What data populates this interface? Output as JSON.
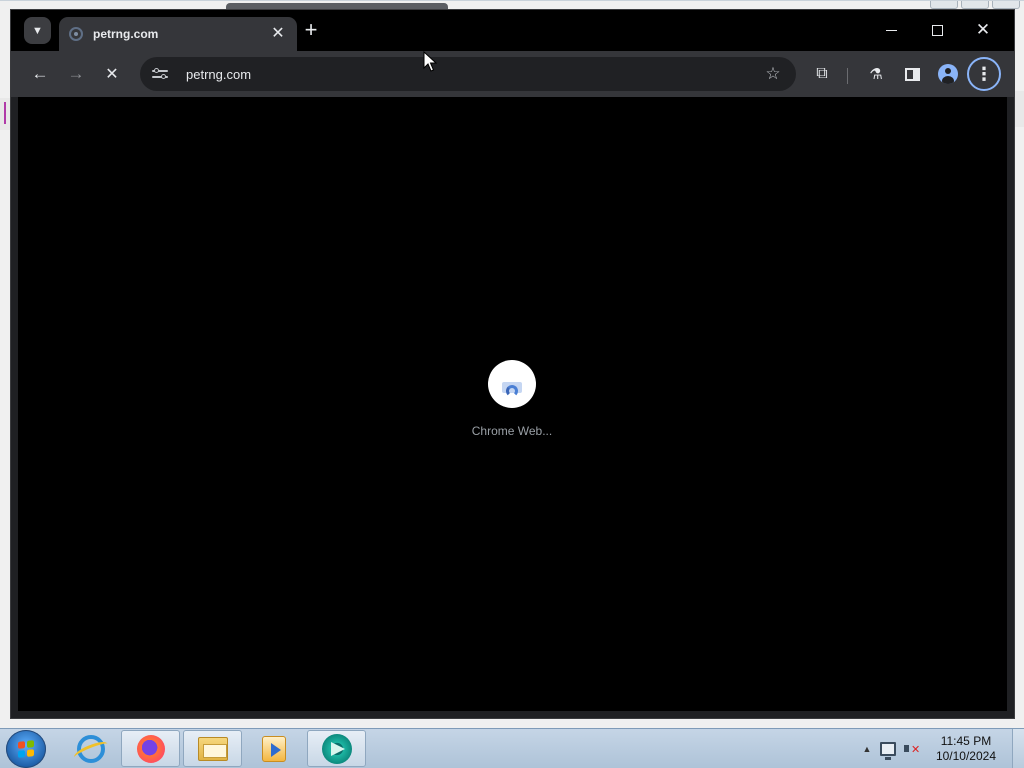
{
  "browser": {
    "tab": {
      "title": "petrng.com",
      "close_glyph": "✕"
    },
    "new_tab_glyph": "+",
    "window_controls": {
      "close_glyph": "✕"
    },
    "toolbar": {
      "back_glyph": "←",
      "forward_glyph": "→",
      "stop_glyph": "✕",
      "url": "petrng.com",
      "bookmark_glyph": "☆",
      "extensions_glyph": "⧉",
      "labs_glyph": "⚗",
      "menu_glyph": "⋮"
    },
    "page": {
      "loading_label": "Chrome Web..."
    }
  },
  "taskbar": {
    "pinned_apps": [
      "internet-explorer",
      "firefox",
      "windows-explorer",
      "windows-media-player",
      "chrome-webstore-app"
    ],
    "clock": {
      "time": "11:45 PM",
      "date": "10/10/2024"
    },
    "tray_arrow_glyph": "▲"
  },
  "icons": {
    "tab_favicon": "globe-icon",
    "site_info": "tune-icon",
    "loader": "webstore-bag-icon",
    "start": "windows-logo-icon"
  },
  "colors": {
    "chrome_frame": "#000000",
    "toolbar": "#35363a",
    "omnibox": "#202124",
    "accent_blue": "#8ab4f8",
    "page_background": "#000000",
    "taskbar": "#b8cbde"
  }
}
